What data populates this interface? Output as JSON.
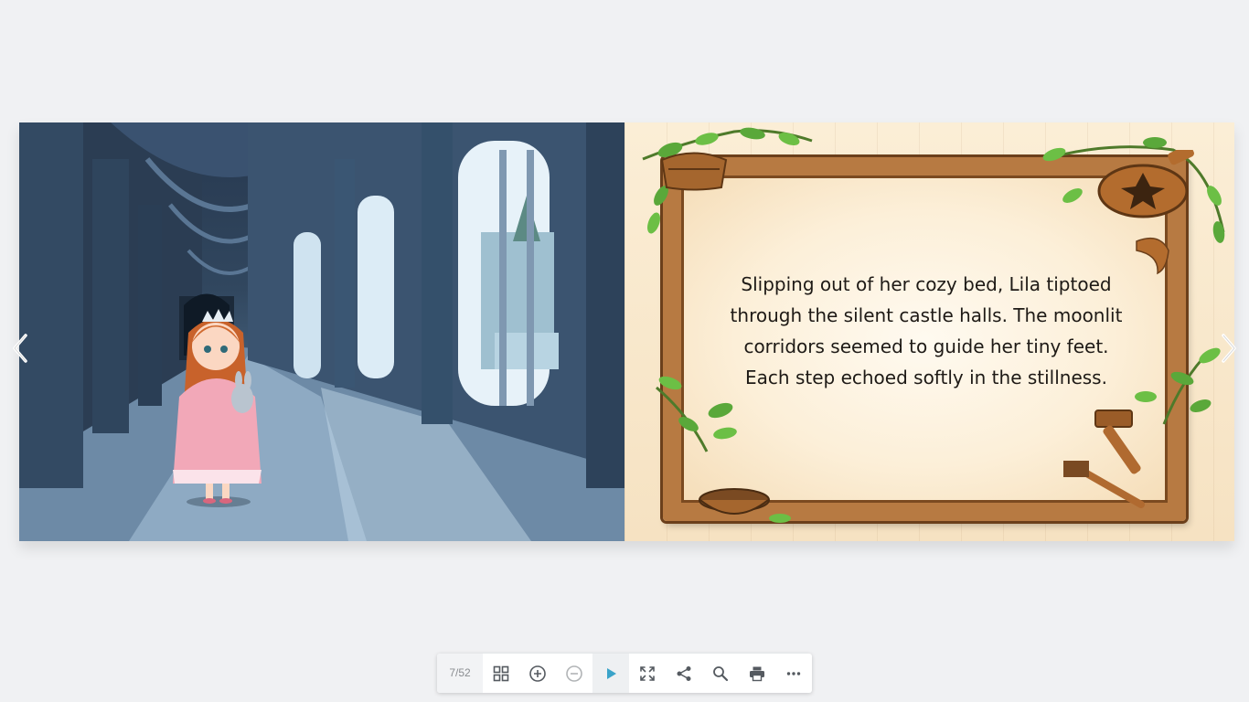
{
  "viewer": {
    "page_indicator": "7/52"
  },
  "story": {
    "lines": [
      "Slipping out of her cozy bed, Lila tiptoed",
      "through the silent castle halls. The moonlit",
      "corridors seemed to guide her tiny feet.",
      "Each step echoed softly in the stillness."
    ]
  },
  "navigation": {
    "prev_icon": "chevron-left-icon",
    "next_icon": "chevron-right-icon"
  },
  "toolbar": {
    "buttons": [
      {
        "name": "thumbnails-button",
        "icon": "grid-icon"
      },
      {
        "name": "zoom-in-button",
        "icon": "plus-circle-icon"
      },
      {
        "name": "zoom-out-button",
        "icon": "minus-circle-icon",
        "disabled": true
      },
      {
        "name": "autoplay-button",
        "icon": "play-icon",
        "active": true
      },
      {
        "name": "fullscreen-button",
        "icon": "expand-icon"
      },
      {
        "name": "share-button",
        "icon": "share-icon"
      },
      {
        "name": "search-button",
        "icon": "search-icon"
      },
      {
        "name": "print-button",
        "icon": "printer-icon"
      },
      {
        "name": "more-button",
        "icon": "more-dots-icon"
      }
    ]
  },
  "colors": {
    "background": "#f0f1f3",
    "play_accent": "#3aa3c9",
    "toolbar_icon": "#555a60",
    "wood": "#b77a42"
  }
}
